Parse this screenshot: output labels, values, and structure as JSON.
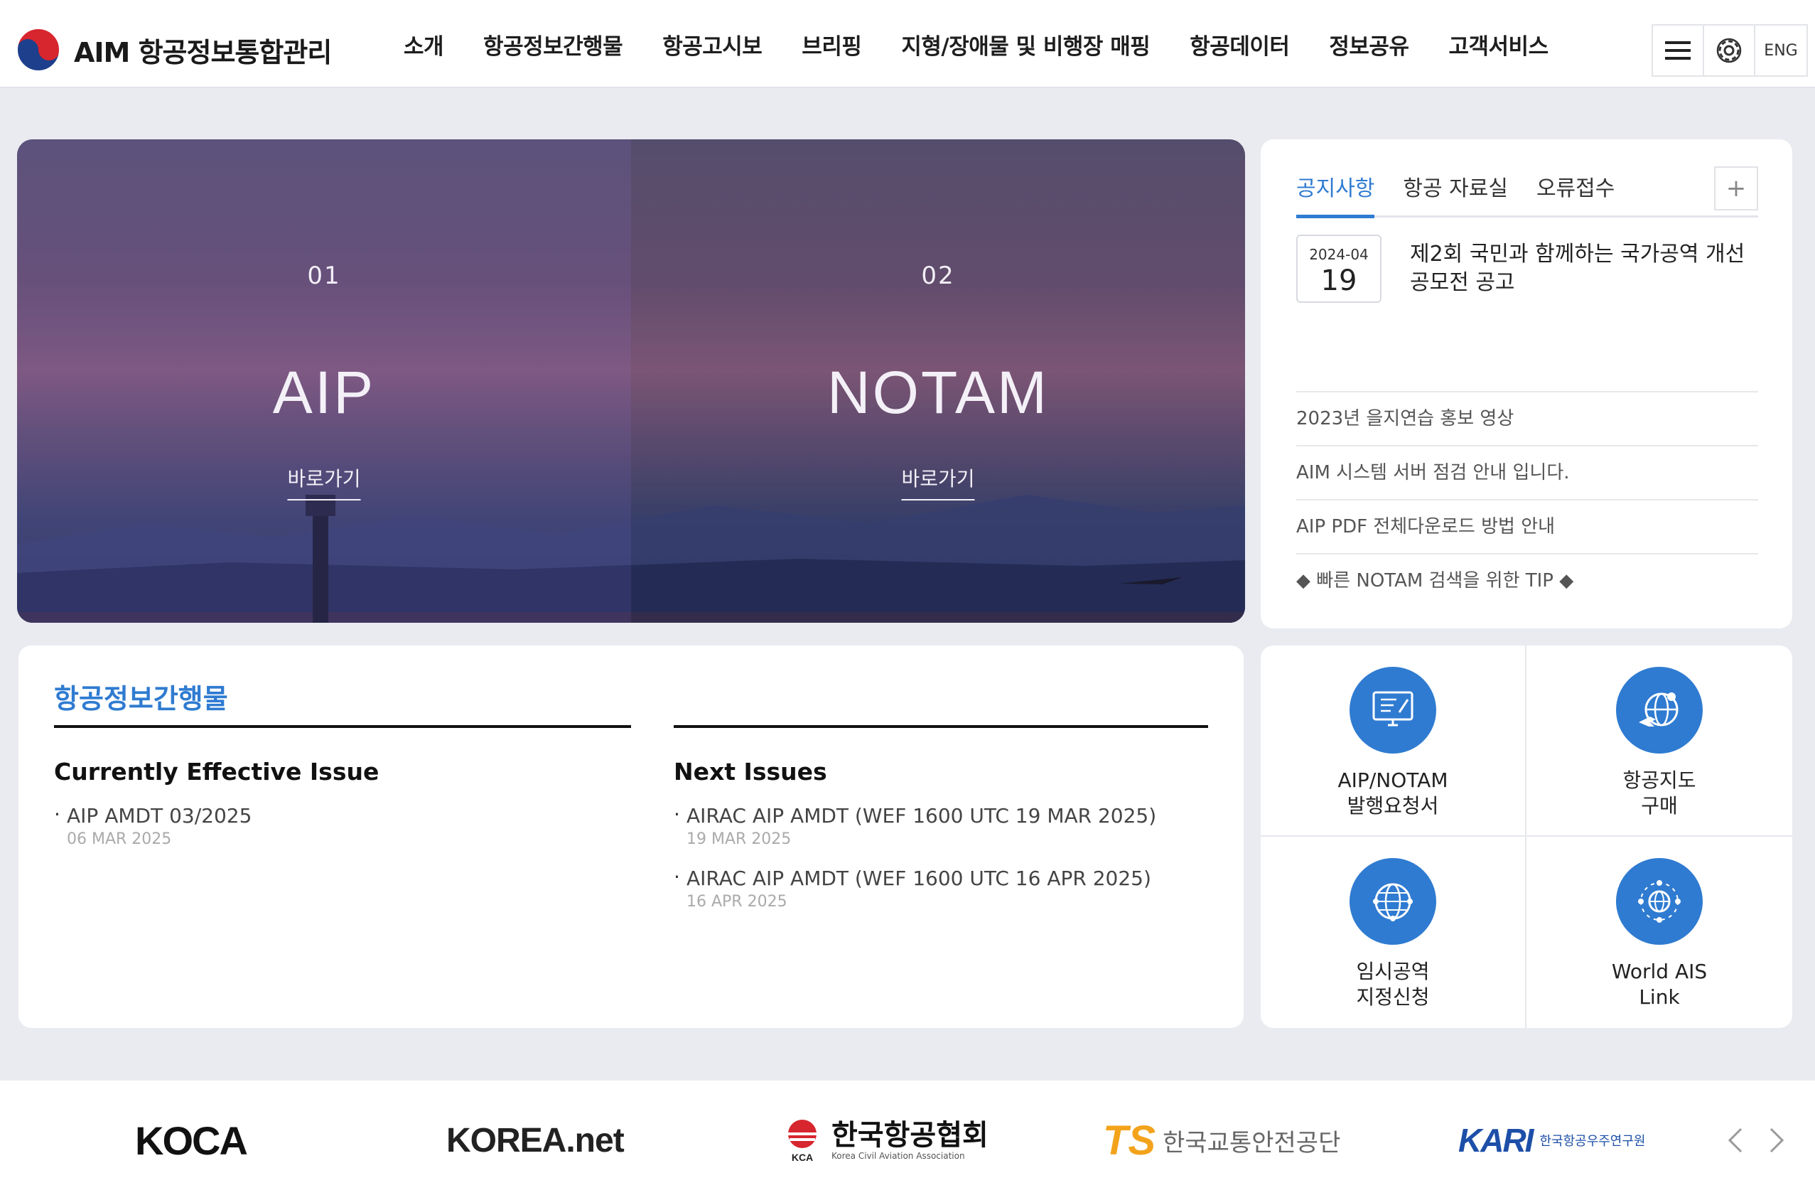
{
  "header": {
    "logo_text": "AIM 항공정보통합관리",
    "nav": [
      "소개",
      "항공정보간행물",
      "항공고시보",
      "브리핑",
      "지형/장애물 및 비행장 매핑",
      "항공데이터",
      "정보공유",
      "고객서비스"
    ],
    "utility": {
      "menu_icon": "hamburger-menu-icon",
      "settings_icon": "gear-icon",
      "lang_label": "ENG"
    }
  },
  "hero": {
    "panels": [
      {
        "num": "01",
        "title": "AIP",
        "link": "바로가기"
      },
      {
        "num": "02",
        "title": "NOTAM",
        "link": "바로가기"
      }
    ]
  },
  "notice": {
    "tabs": [
      "공지사항",
      "항공 자료실",
      "오류접수"
    ],
    "active_tab": "공지사항",
    "more_label": "+",
    "featured": {
      "date_ym": "2024-04",
      "date_d": "19",
      "title": "제2회 국민과 함께하는 국가공역 개선 공모전 공고"
    },
    "items": [
      "2023년 을지연습 홍보 영상",
      "AIM 시스템 서버 점검 안내 입니다.",
      "AIP PDF 전체다운로드 방법 안내",
      "◆ 빠른 NOTAM 검색을 위한 TIP ◆"
    ]
  },
  "publications": {
    "title": "항공정보간행물",
    "current": {
      "heading": "Currently Effective Issue",
      "items": [
        {
          "name": "AIP AMDT 03/2025",
          "date": "06 MAR 2025"
        }
      ]
    },
    "next": {
      "heading": "Next Issues",
      "items": [
        {
          "name": "AIRAC AIP AMDT (WEF 1600 UTC 19 MAR 2025)",
          "date": "19 MAR 2025"
        },
        {
          "name": "AIRAC AIP AMDT (WEF 1600 UTC 16 APR 2025)",
          "date": "16 APR 2025"
        }
      ]
    }
  },
  "quick_links": [
    {
      "line1": "AIP/NOTAM",
      "line2": "발행요청서",
      "icon": "document-monitor-icon"
    },
    {
      "line1": "항공지도",
      "line2": "구매",
      "icon": "globe-plane-pin-icon"
    },
    {
      "line1": "임시공역",
      "line2": "지정신청",
      "icon": "globe-network-icon"
    },
    {
      "line1": "World AIS",
      "line2": "Link",
      "icon": "world-network-icon"
    }
  ],
  "partners": [
    {
      "name": "KOCA",
      "icon": "koca-logo"
    },
    {
      "name": "KOREA.net",
      "icon": "korea-net-logo"
    },
    {
      "name": "한국항공협회",
      "sub": "Korea Civil Aviation Association",
      "icon": "kca-logo"
    },
    {
      "name": "한국교통안전공단",
      "mark": "TS",
      "icon": "ts-logo"
    },
    {
      "name": "한국항공우주연구원",
      "mark": "KARI",
      "icon": "kari-logo"
    }
  ],
  "colors": {
    "accent": "#2f7bd1",
    "background": "#e9ebf0"
  }
}
